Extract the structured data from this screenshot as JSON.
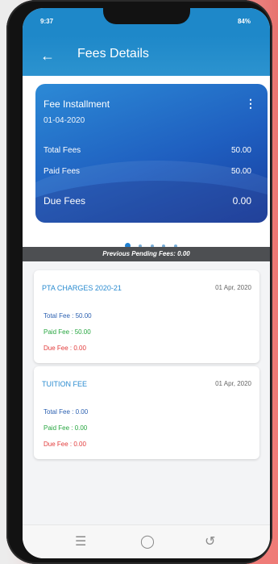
{
  "status_bar": {
    "left": "9:37",
    "right": "84%"
  },
  "app_bar": {
    "title": "Fees Details"
  },
  "summary_card": {
    "title": "Fee Installment",
    "date": "01-04-2020",
    "menu_icon": "kebab-icon",
    "rows": [
      {
        "label": "Total Fees",
        "value": "50.00"
      },
      {
        "label": "Paid Fees",
        "value": "50.00"
      },
      {
        "label": "Due Fees",
        "value": "0.00"
      }
    ]
  },
  "carousel": {
    "page_count": 5,
    "active_index": 0
  },
  "pending_banner": "Previous Pending Fees: 0.00",
  "fee_items": [
    {
      "title": "PTA CHARGES 2020-21",
      "date": "01 Apr, 2020",
      "total": "Total Fee : 50.00",
      "paid": "Paid Fee : 50.00",
      "due": "Due Fee : 0.00"
    },
    {
      "title": "TUITION FEE",
      "date": "01 Apr, 2020",
      "total": "Total Fee : 0.00",
      "paid": "Paid Fee : 0.00",
      "due": "Due Fee : 0.00"
    }
  ],
  "nav": {
    "menu_icon": "menu-icon",
    "home_icon": "home-icon",
    "back_icon": "back-icon"
  }
}
